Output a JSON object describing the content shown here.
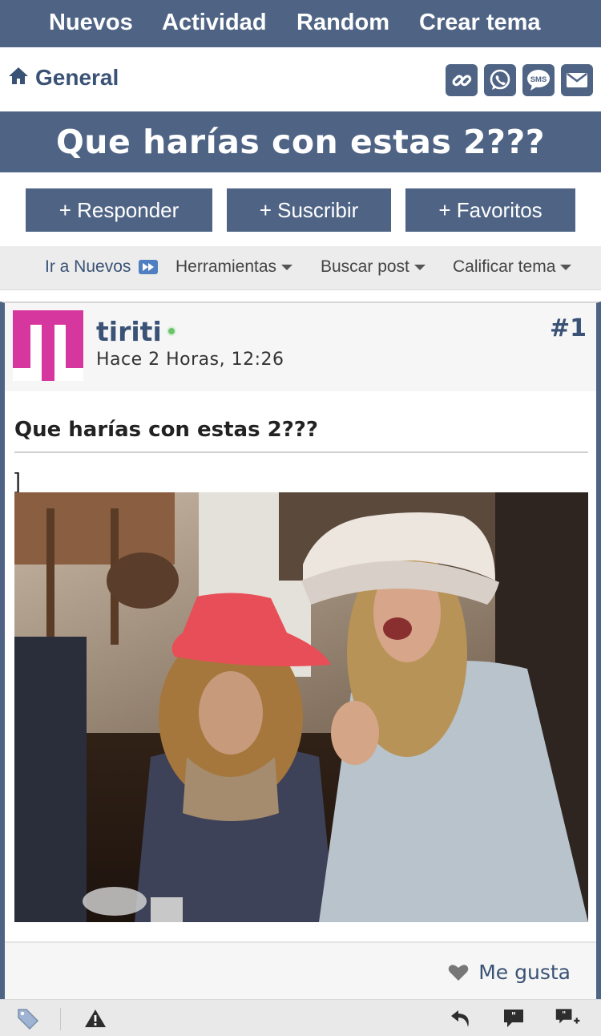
{
  "topnav": {
    "items": [
      "Nuevos",
      "Actividad",
      "Random",
      "Crear tema"
    ]
  },
  "breadcrumb": {
    "label": "General",
    "icon": "home-icon"
  },
  "share": {
    "icons": [
      "link-icon",
      "whatsapp-icon",
      "sms-icon",
      "mail-icon"
    ],
    "sms_text": "SMS"
  },
  "thread": {
    "title": "Que harías con estas 2???"
  },
  "actions": {
    "reply": "+ Responder",
    "subscribe": "+ Suscribir",
    "favorites": "+ Favoritos"
  },
  "tools": {
    "go_new": "Ir a Nuevos",
    "tools": "Herramientas",
    "search": "Buscar post",
    "rate": "Calificar tema"
  },
  "post": {
    "username": "tiriti",
    "time": "Hace 2 Horas, 12:26",
    "number": "#1",
    "title": "Que harías con estas 2???",
    "text": "]",
    "like_label": "Me gusta"
  },
  "bottombar": {
    "icons": [
      "tag-icon",
      "warning-icon",
      "undo-icon",
      "quote-icon",
      "multiquote-icon"
    ]
  },
  "colors": {
    "nav_bg": "#4f6485",
    "link": "#3a5275",
    "avatar": "#d6379f",
    "online": "#6cc36c"
  }
}
